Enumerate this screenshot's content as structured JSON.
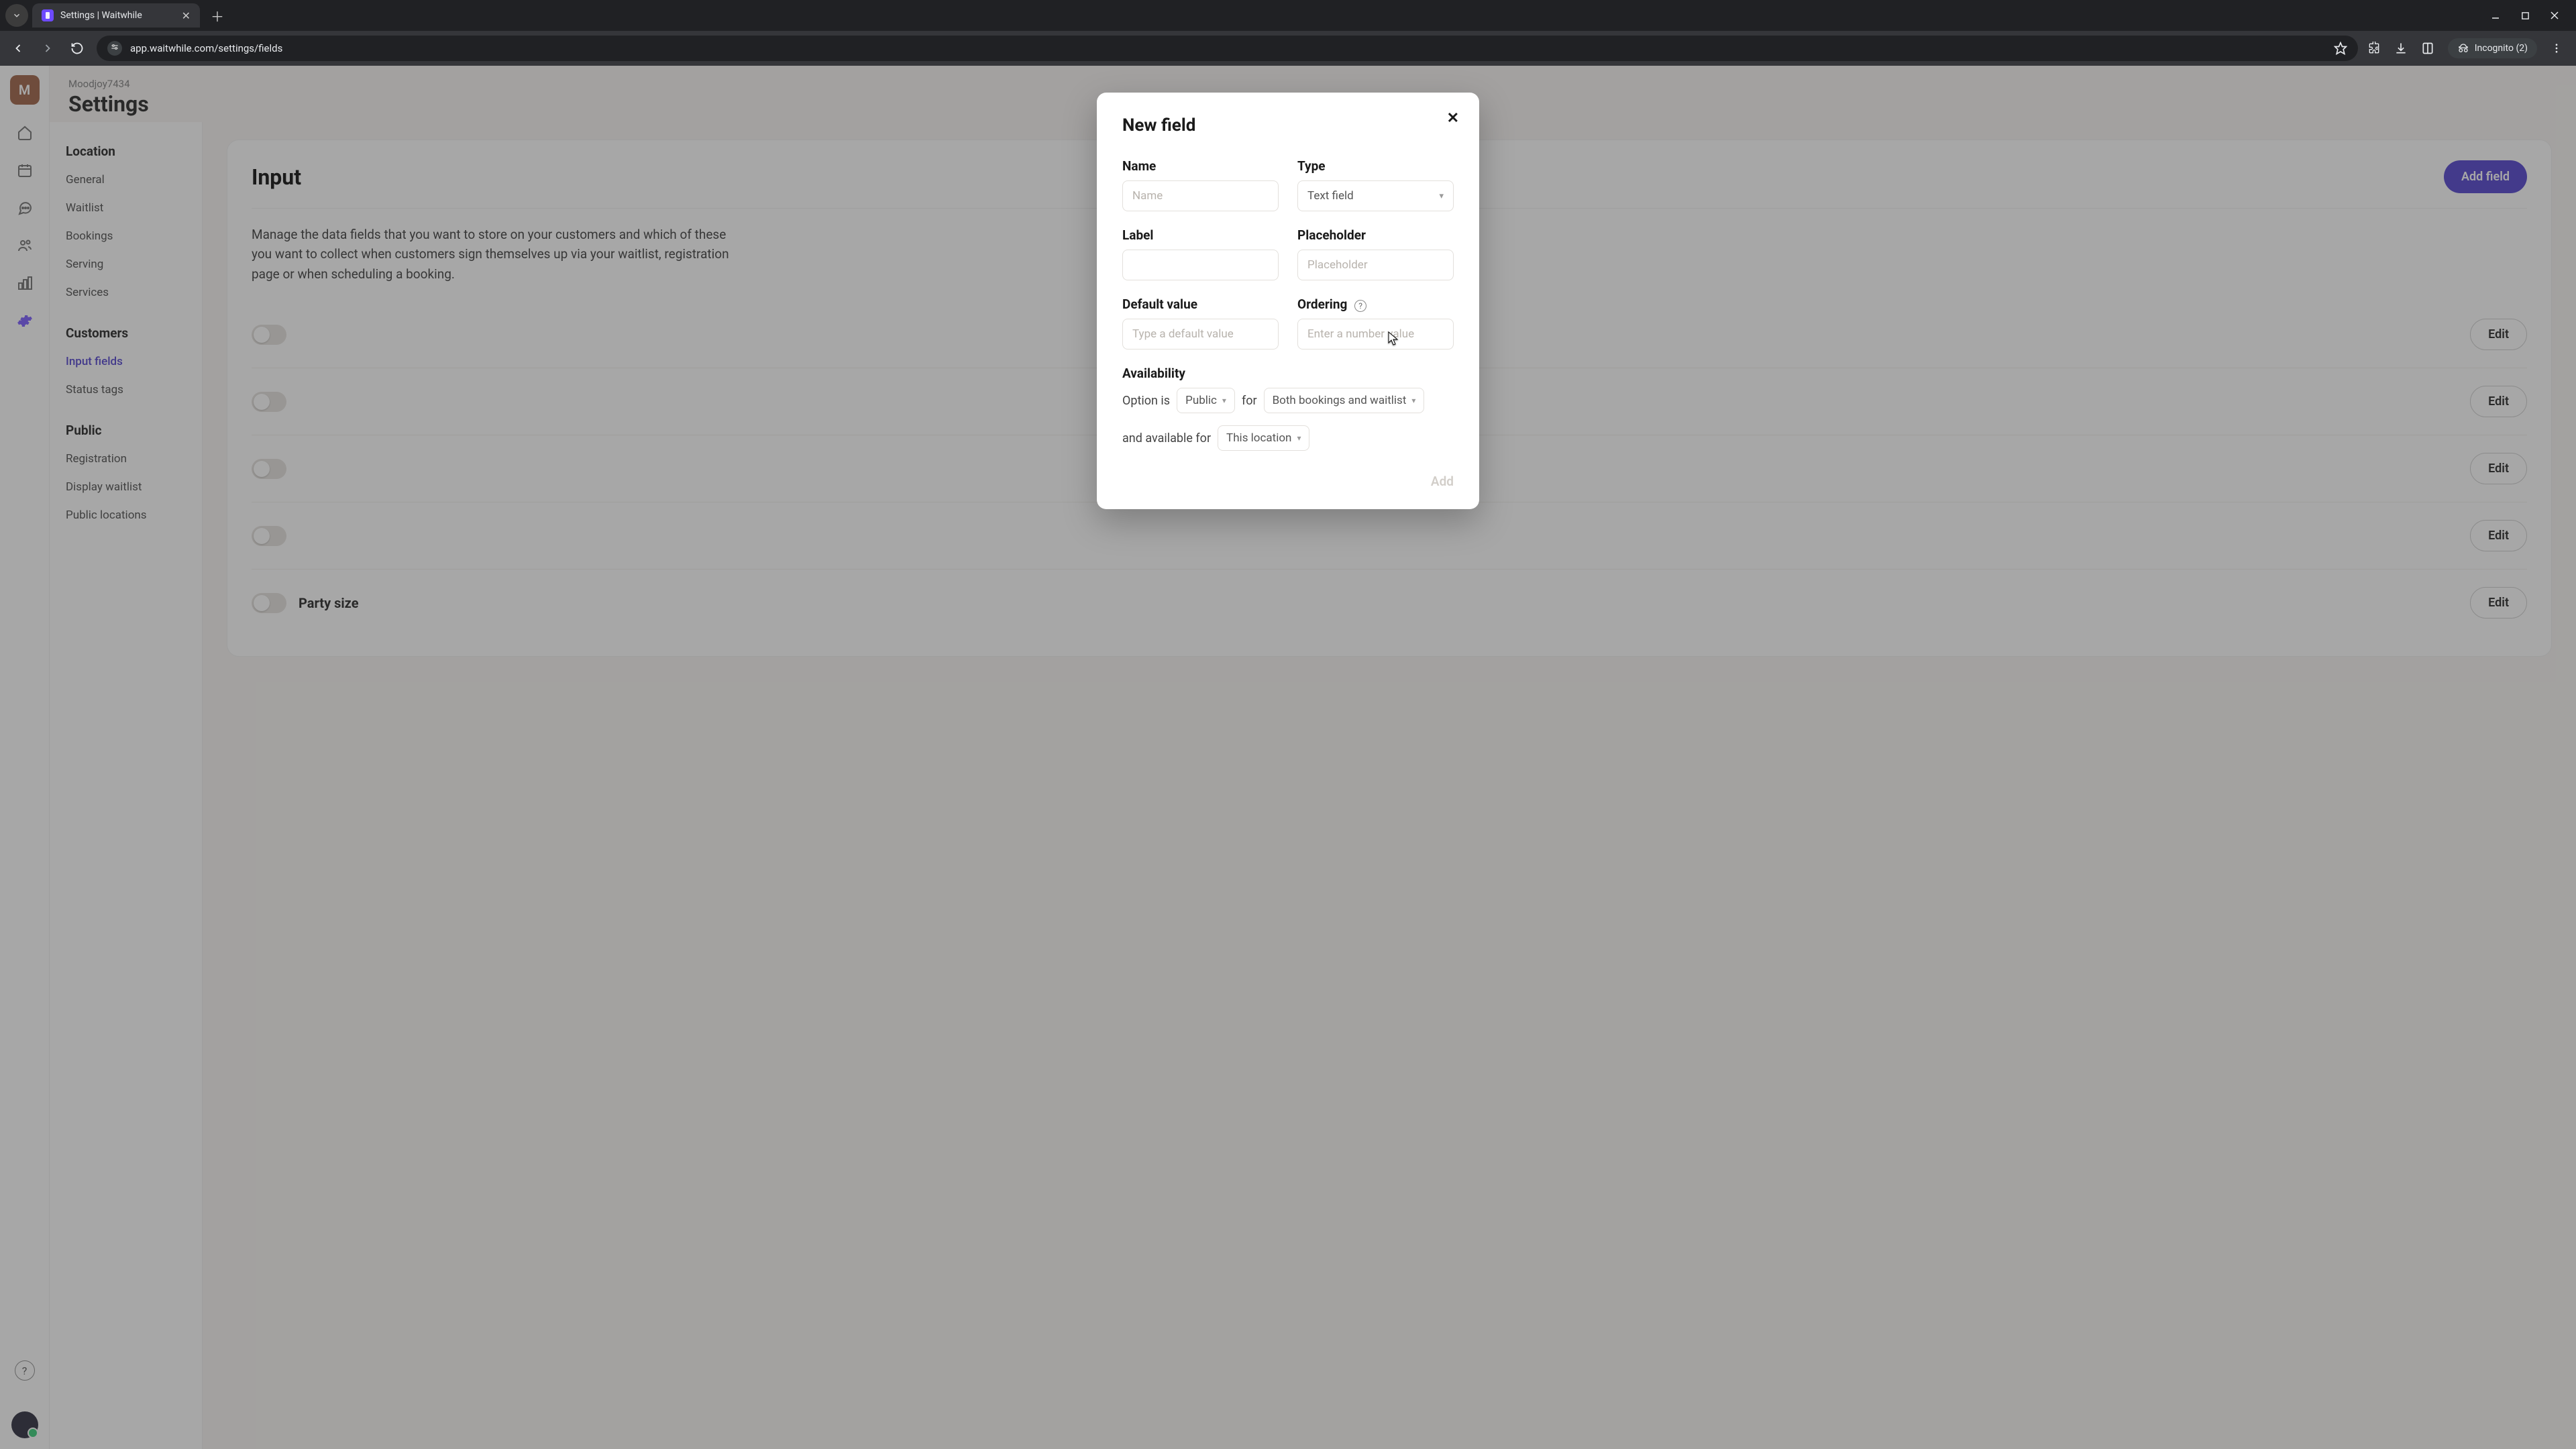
{
  "browser": {
    "tab_title": "Settings | Waitwhile",
    "url": "app.waitwhile.com/settings/fields",
    "incognito_label": "Incognito (2)"
  },
  "header": {
    "org": "Moodjoy7434",
    "title": "Settings",
    "avatar_letter": "M"
  },
  "sidenav": {
    "sections": [
      {
        "title": "Location",
        "items": [
          "General",
          "Waitlist",
          "Bookings",
          "Serving",
          "Services"
        ]
      },
      {
        "title": "Customers",
        "items": [
          "Input fields",
          "Status tags"
        ]
      },
      {
        "title": "Public",
        "items": [
          "Registration",
          "Display waitlist",
          "Public locations"
        ]
      }
    ],
    "active": "Input fields"
  },
  "panel": {
    "title": "Input",
    "add_button": "Add field",
    "desc": "Manage the data fields that you want to store on your customers and which of these you want to collect when customers sign themselves up via your waitlist, registration page or when scheduling a booking.",
    "edit_label": "Edit",
    "rows": [
      "",
      "",
      "",
      "",
      "Party size"
    ]
  },
  "modal": {
    "title": "New field",
    "labels": {
      "name": "Name",
      "type": "Type",
      "label": "Label",
      "placeholder": "Placeholder",
      "default": "Default value",
      "ordering": "Ordering",
      "availability": "Availability"
    },
    "placeholders": {
      "name": "Name",
      "placeholder": "Placeholder",
      "default": "Type a default value",
      "ordering": "Enter a number value"
    },
    "type_value": "Text field",
    "avail": {
      "prefix": "Option is",
      "visibility": "Public",
      "for_word": "for",
      "scope": "Both bookings and waitlist",
      "and": "and available for",
      "location": "This location"
    },
    "add_label": "Add"
  }
}
